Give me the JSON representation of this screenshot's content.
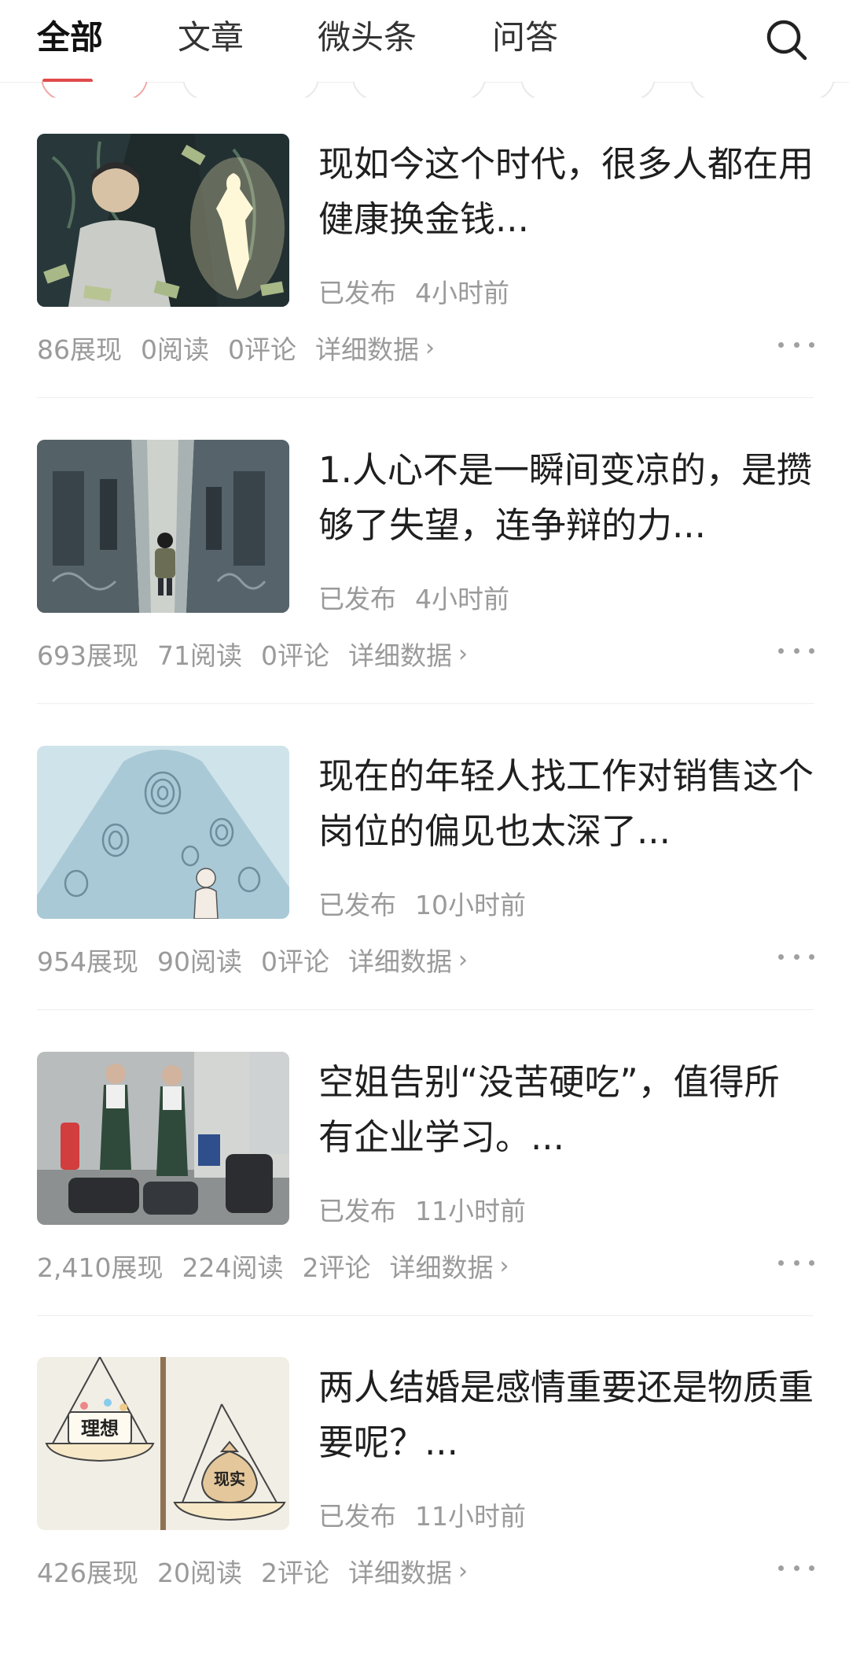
{
  "tabs": [
    {
      "label": "全部",
      "active": true
    },
    {
      "label": "文章"
    },
    {
      "label": "微头条"
    },
    {
      "label": "问答"
    }
  ],
  "search_icon": "search-icon",
  "accent_color": "#e14a4a",
  "articles": [
    {
      "title": "现如今这个时代，很多人都在用健康换金钱...",
      "status": "已发布",
      "time": "4小时前",
      "impressions": "86展现",
      "reads": "0阅读",
      "comments": "0评论",
      "detail_label": "详细数据"
    },
    {
      "title": "1.人心不是一瞬间变凉的，是攒够了失望，连争辩的力...",
      "status": "已发布",
      "time": "4小时前",
      "impressions": "693展现",
      "reads": "71阅读",
      "comments": "0评论",
      "detail_label": "详细数据"
    },
    {
      "title": "现在的年轻人找工作对销售这个岗位的偏见也太深了...",
      "status": "已发布",
      "time": "10小时前",
      "impressions": "954展现",
      "reads": "90阅读",
      "comments": "0评论",
      "detail_label": "详细数据"
    },
    {
      "title": "空姐告别“没苦硬吃”，值得所有企业学习。...",
      "status": "已发布",
      "time": "11小时前",
      "impressions": "2,410展现",
      "reads": "224阅读",
      "comments": "2评论",
      "detail_label": "详细数据"
    },
    {
      "title": "两人结婚是感情重要还是物质重要呢？...",
      "status": "已发布",
      "time": "11小时前",
      "impressions": "426展现",
      "reads": "20阅读",
      "comments": "2评论",
      "detail_label": "详细数据",
      "thumb_text_left": "理想",
      "thumb_text_right": "现实"
    }
  ]
}
